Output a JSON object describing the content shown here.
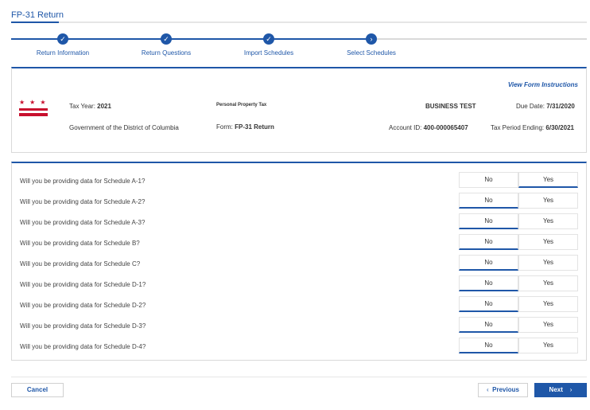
{
  "page_title": "FP-31 Return",
  "steps": [
    {
      "label": "Return Information",
      "state": "complete",
      "icon": "check-icon"
    },
    {
      "label": "Return Questions",
      "state": "complete",
      "icon": "check-icon"
    },
    {
      "label": "Import Schedules",
      "state": "complete",
      "icon": "check-icon"
    },
    {
      "label": "Select Schedules",
      "state": "current",
      "icon": "chevron-right-icon"
    }
  ],
  "info": {
    "view_instructions": "View Form Instructions",
    "tax_year_label": "Tax Year:",
    "tax_year": "2021",
    "agency": "Government of the District of Columbia",
    "tax_type": "Personal Property Tax",
    "form_label": "Form:",
    "form": "FP-31 Return",
    "business": "BUSINESS TEST",
    "account_label": "Account ID:",
    "account": "400-000065407",
    "due_label": "Due Date:",
    "due": "7/31/2020",
    "period_label": "Tax Period Ending:",
    "period": "6/30/2021"
  },
  "options": {
    "no": "No",
    "yes": "Yes"
  },
  "questions": [
    {
      "text": "Will you be providing data for Schedule A-1?",
      "selected": "Yes"
    },
    {
      "text": "Will you be providing data for Schedule A-2?",
      "selected": "No"
    },
    {
      "text": "Will you be providing data for Schedule A-3?",
      "selected": "No"
    },
    {
      "text": "Will you be providing data for Schedule B?",
      "selected": "No"
    },
    {
      "text": "Will you be providing data for Schedule C?",
      "selected": "No"
    },
    {
      "text": "Will you be providing data for Schedule D-1?",
      "selected": "No"
    },
    {
      "text": "Will you be providing data for Schedule D-2?",
      "selected": "No"
    },
    {
      "text": "Will you be providing data for Schedule D-3?",
      "selected": "No"
    },
    {
      "text": "Will you be providing data for Schedule D-4?",
      "selected": "No"
    }
  ],
  "buttons": {
    "cancel": "Cancel",
    "previous": "Previous",
    "next": "Next"
  },
  "colors": {
    "accent": "#1f57a8",
    "flag_red": "#c8102e"
  }
}
